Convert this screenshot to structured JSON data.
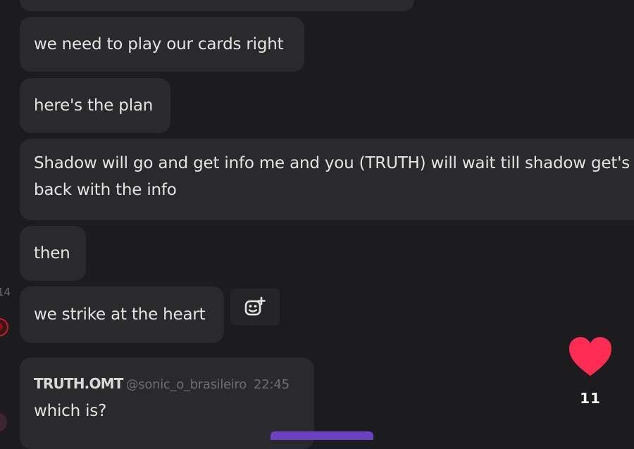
{
  "messages": [
    {
      "text": "we need to play our cards right"
    },
    {
      "text": "here's the plan"
    },
    {
      "text": "Shadow will go and get info me and you (TRUTH) will wait till shadow get's back with the info"
    },
    {
      "text": "then"
    },
    {
      "text": "we strike at the heart"
    }
  ],
  "left_timestamp": "14",
  "reply": {
    "author": "TRUTH.OMT",
    "handle": "@sonic_o_brasileiro",
    "time": "22:45",
    "text": "which is?"
  },
  "overlay": {
    "like_count": "11",
    "like_color": "#fe2c55"
  },
  "icons": {
    "add_reaction": "add-reaction-icon",
    "heart": "heart-icon"
  }
}
